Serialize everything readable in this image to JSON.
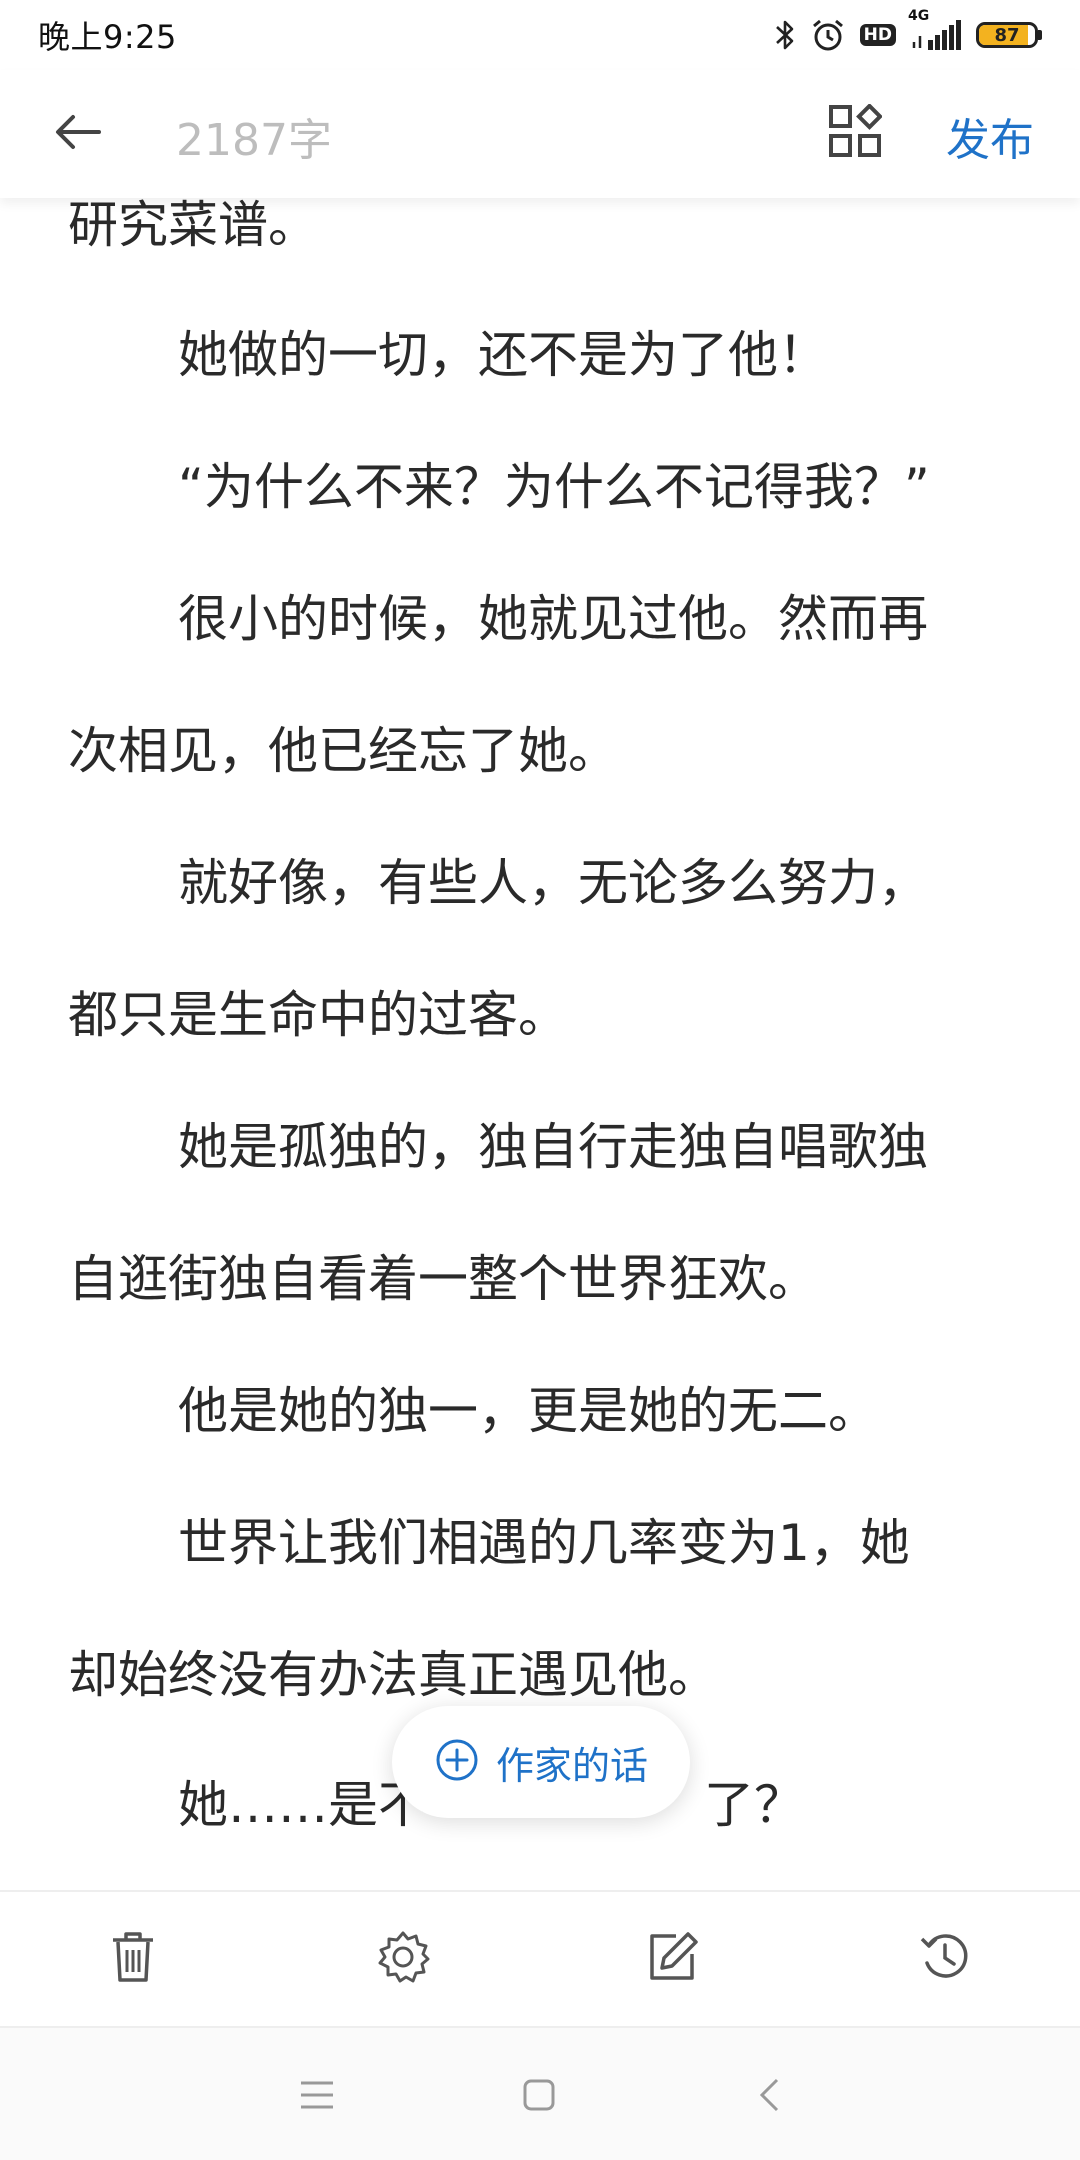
{
  "status_bar": {
    "time": "晚上9:25",
    "network": "4G",
    "hd": "HD",
    "battery": "87",
    "battery_level": 0.87,
    "icons": [
      "bluetooth-icon",
      "alarm-icon",
      "hd-icon",
      "signal-icon",
      "battery-icon"
    ]
  },
  "header": {
    "word_count": "2187字",
    "publish_label": "发布",
    "icons": [
      "back-arrow-icon",
      "layout-grid-icon"
    ]
  },
  "content": {
    "paragraphs": [
      "研究菜谱。",
      "她做的一切，还不是为了他！",
      "“为什么不来？为什么不记得我？”",
      "很小的时候，她就见过他。然而再",
      "次相见，他已经忘了她。",
      "就好像，有些人，无论多么努力，",
      "都只是生命中的过客。",
      "她是孤独的，独自行走独自唱歌独",
      "自逛街独自看着一整个世界狂欢。",
      "他是她的独一，更是她的无二。",
      "世界让我们相遇的几率变为1，她",
      "却始终没有办法真正遇见他。",
      "她……是不",
      "了？"
    ]
  },
  "author_note": {
    "label": "作家的话",
    "icon": "plus-circle-icon"
  },
  "toolbar": {
    "icons": [
      "trash-icon",
      "settings-gear-icon",
      "edit-icon",
      "history-icon"
    ]
  },
  "nav_bar": {
    "icons": [
      "menu-icon",
      "home-square-icon",
      "back-chevron-icon"
    ]
  },
  "colors": {
    "accent": "#1f72c8",
    "text": "#2a2a2a",
    "muted": "#bdbdbd",
    "battery": "#f3b21f"
  }
}
